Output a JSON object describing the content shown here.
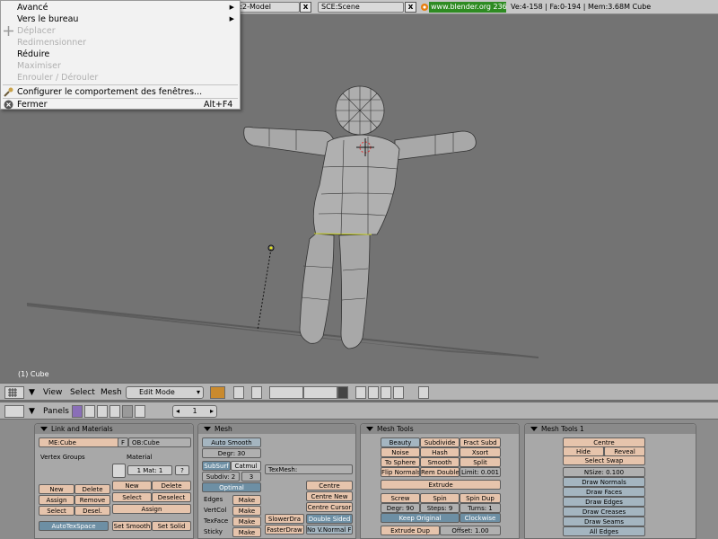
{
  "topbar": {
    "scene_field": "R:2-Model",
    "scene_select": "SCE:Scene",
    "url": "www.blender.org 236",
    "stats": "Ve:4-158 | Fa:0-194 | Mem:3.68M Cube"
  },
  "menu": {
    "items": [
      {
        "label": "Avancé",
        "disabled": false,
        "submenu": true
      },
      {
        "label": "Vers le bureau",
        "disabled": false,
        "submenu": true
      },
      {
        "label": "Déplacer",
        "disabled": true
      },
      {
        "label": "Redimensionner",
        "disabled": true
      },
      {
        "label": "Réduire",
        "disabled": false
      },
      {
        "label": "Maximiser",
        "disabled": true
      },
      {
        "label": "Enrouler / Dérouler",
        "disabled": true
      },
      {
        "label": "Configurer le comportement des fenêtres...",
        "disabled": false
      },
      {
        "label": "Fermer",
        "disabled": false,
        "shortcut": "Alt+F4"
      }
    ]
  },
  "viewport": {
    "object_info": "(1) Cube"
  },
  "header3d": {
    "view": "View",
    "select": "Select",
    "mesh": "Mesh",
    "mode": "Edit Mode"
  },
  "buttons_header": {
    "panels": "Panels",
    "frame": "1"
  },
  "panels": {
    "link_materials": {
      "title": "Link and Materials",
      "me_field": "ME:Cube",
      "f_label": "F",
      "ob_field": "OB:Cube",
      "vertex_groups": "Vertex Groups",
      "material": "Material",
      "mat_value": "1 Mat: 1",
      "question": "?",
      "new1": "New",
      "delete1": "Delete",
      "assign1": "Assign",
      "remove": "Remove",
      "select1": "Select",
      "desel": "Desel.",
      "new2": "New",
      "delete2": "Delete",
      "select2": "Select",
      "deselect": "Deselect",
      "assign2": "Assign",
      "autotexspace": "AutoTexSpace",
      "set_smooth": "Set Smooth",
      "set_solid": "Set Solid"
    },
    "mesh": {
      "title": "Mesh",
      "auto_smooth": "Auto Smooth",
      "degr": "Degr: 30",
      "subsurf": "SubSurf",
      "catmul": "Catmul",
      "subdiv": "Subdiv: 2",
      "subdiv_r": "3",
      "optimal": "Optimal",
      "texmesh": "TexMesh:",
      "edges": "Edges",
      "vertcol": "VertCol",
      "texface": "TexFace",
      "sticky": "Sticky",
      "make": "Make",
      "centre": "Centre",
      "centre_new": "Centre New",
      "centre_cursor": "Centre Cursor",
      "slower_draw": "SlowerDra",
      "faster_draw": "FasterDraw",
      "double_sided": "Double Sided",
      "no_vnormal": "No V.Normal Fl"
    },
    "mesh_tools": {
      "title": "Mesh Tools",
      "beauty": "Beauty",
      "subdivide": "Subdivide",
      "fract_subd": "Fract Subd",
      "noise": "Noise",
      "hash": "Hash",
      "xsort": "Xsort",
      "to_sphere": "To Sphere",
      "smooth": "Smooth",
      "split": "Split",
      "flip_normals": "Flip Normals",
      "rem_doubles": "Rem Doubles",
      "limit": "Limit: 0.001",
      "extrude": "Extrude",
      "screw": "Screw",
      "spin": "Spin",
      "spin_dup": "Spin Dup",
      "degr": "Degr: 90",
      "steps": "Steps: 9",
      "turns": "Turns: 1",
      "keep_original": "Keep Original",
      "clockwise": "Clockwise",
      "extrude_dup": "Extrude Dup",
      "offset": "Offset: 1.00"
    },
    "mesh_tools1": {
      "title": "Mesh Tools 1",
      "centre": "Centre",
      "hide": "Hide",
      "reveal": "Reveal",
      "select_swap": "Select Swap",
      "nsize": "NSize: 0.100",
      "draw_normals": "Draw Normals",
      "draw_faces": "Draw Faces",
      "draw_edges": "Draw Edges",
      "draw_creases": "Draw Creases",
      "draw_seams": "Draw Seams",
      "all_edges": "All Edges"
    }
  },
  "colors": {
    "viewport": "#737373",
    "button_pink": "#e6c4ac",
    "toggle_blue": "#6d8fa4"
  }
}
